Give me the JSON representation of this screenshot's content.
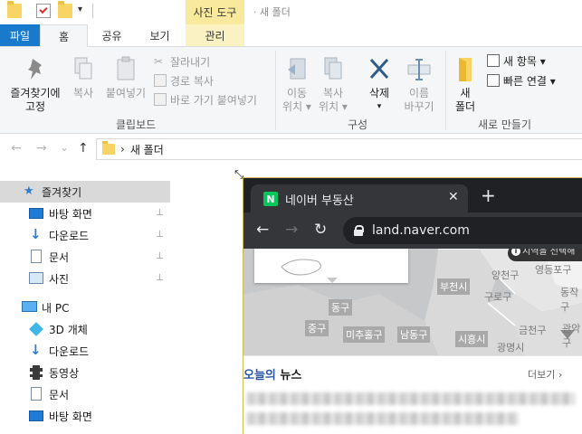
{
  "titlebar": {
    "context_tab_header": "사진 도구",
    "window_title": "새 폴더",
    "qa_dropdown": "▾"
  },
  "tabs": {
    "file": "파일",
    "home": "홈",
    "share": "공유",
    "view": "보기",
    "manage": "관리"
  },
  "ribbon": {
    "pin_quick_line1": "즐겨찾기에",
    "pin_quick_line2": "고정",
    "copy": "복사",
    "paste": "붙여넣기",
    "cut": "잘라내기",
    "copy_path": "경로 복사",
    "paste_shortcut": "바로 가기 붙여넣기",
    "clipboard_group": "클립보드",
    "move_to_line1": "이동",
    "move_to_line2": "위치 ▾",
    "copy_to_line1": "복사",
    "copy_to_line2": "위치 ▾",
    "delete": "삭제",
    "delete_arrow": "▾",
    "rename_line1": "이름",
    "rename_line2": "바꾸기",
    "organize_group": "구성",
    "new_folder_line1": "새",
    "new_folder_line2": "폴더",
    "new_item": "새 항목 ▾",
    "easy_access": "빠른 연결 ▾",
    "new_group": "새로 만들기"
  },
  "navbar": {
    "back": "←",
    "forward": "→",
    "recent": "⌄",
    "up": "↑",
    "separator": "›",
    "path": "새 폴더"
  },
  "sidebar": {
    "items": [
      {
        "label": "즐겨찾기"
      },
      {
        "label": "바탕 화면"
      },
      {
        "label": "다운로드"
      },
      {
        "label": "문서"
      },
      {
        "label": "사진"
      },
      {
        "label": "내 PC"
      },
      {
        "label": "3D 개체"
      },
      {
        "label": "다운로드"
      },
      {
        "label": "동영상"
      },
      {
        "label": "문서"
      },
      {
        "label": "바탕 화면"
      }
    ],
    "pin_glyph": "📌"
  },
  "chrome": {
    "tab_favicon": "N",
    "tab_title": "네이버 부동산",
    "tab_close": "✕",
    "new_tab": "+",
    "back": "←",
    "forward": "→",
    "reload": "↻",
    "url": "land.naver.com",
    "map_tip": "지역을 선택해",
    "map_labels": {
      "l1": "부천시",
      "l2": "양천구",
      "l3": "영등포구",
      "l4": "구로구",
      "l5": "동작구",
      "l6": "동구",
      "l7": "중구",
      "l8": "미추홀구",
      "l9": "남동구",
      "l10": "시흥시",
      "l11": "금천구",
      "l12": "관악구",
      "l13": "광명시"
    },
    "news_title_accent": "오늘의",
    "news_title_rest": " 뉴스",
    "news_more": "더보기 ›"
  }
}
